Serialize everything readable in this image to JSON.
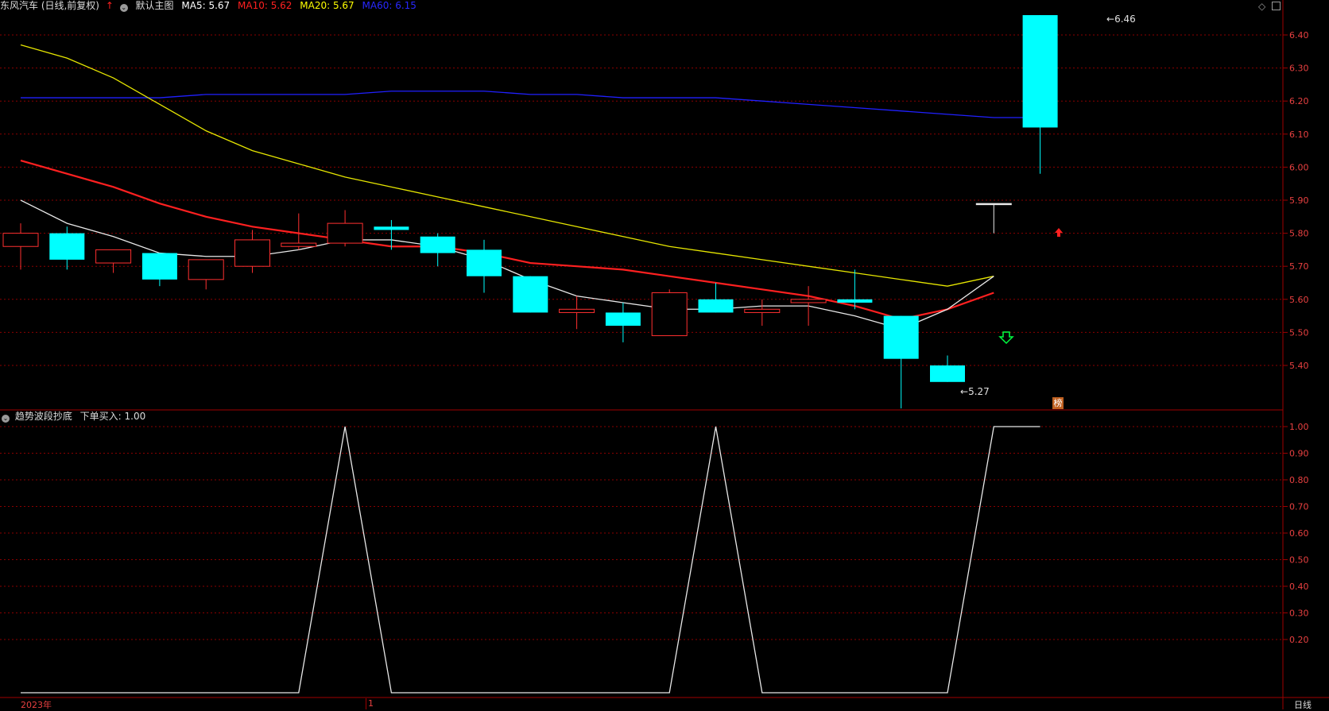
{
  "header": {
    "stock_title": "东风汽车 (日线,前复权)",
    "template_label": "默认主图",
    "ma": [
      {
        "label": "MA5: 5.67",
        "color": "#ffffff"
      },
      {
        "label": "MA10: 5.62",
        "color": "#ff2020"
      },
      {
        "label": "MA20: 5.67",
        "color": "#ffff00"
      },
      {
        "label": "MA60: 6.15",
        "color": "#2020ff"
      }
    ]
  },
  "indicator_header": {
    "name": "趋势波段抄底",
    "value_label": "下单买入: 1.00"
  },
  "bottom": {
    "year_label": "2023年",
    "month_label": "1",
    "period_label": "日线"
  },
  "markers": {
    "low_label": "5.27",
    "high_label": "6.46",
    "bang_label": "榜"
  },
  "chart_data": [
    {
      "type": "candlestick",
      "ylim": [
        5.27,
        6.46
      ],
      "yticks": [
        "6.40",
        "6.30",
        "6.20",
        "6.10",
        "6.00",
        "5.90",
        "5.80",
        "5.70",
        "5.60",
        "5.50",
        "5.40"
      ],
      "candles": [
        {
          "o": 5.76,
          "h": 5.83,
          "l": 5.69,
          "c": 5.8
        },
        {
          "o": 5.8,
          "h": 5.82,
          "l": 5.69,
          "c": 5.72
        },
        {
          "o": 5.71,
          "h": 5.75,
          "l": 5.68,
          "c": 5.75
        },
        {
          "o": 5.74,
          "h": 5.74,
          "l": 5.64,
          "c": 5.66
        },
        {
          "o": 5.66,
          "h": 5.72,
          "l": 5.63,
          "c": 5.72
        },
        {
          "o": 5.7,
          "h": 5.81,
          "l": 5.68,
          "c": 5.78
        },
        {
          "o": 5.76,
          "h": 5.86,
          "l": 5.75,
          "c": 5.77
        },
        {
          "o": 5.77,
          "h": 5.87,
          "l": 5.76,
          "c": 5.83
        },
        {
          "o": 5.82,
          "h": 5.84,
          "l": 5.75,
          "c": 5.81
        },
        {
          "o": 5.79,
          "h": 5.8,
          "l": 5.7,
          "c": 5.74
        },
        {
          "o": 5.75,
          "h": 5.78,
          "l": 5.62,
          "c": 5.67
        },
        {
          "o": 5.67,
          "h": 5.67,
          "l": 5.56,
          "c": 5.56
        },
        {
          "o": 5.56,
          "h": 5.61,
          "l": 5.51,
          "c": 5.57
        },
        {
          "o": 5.56,
          "h": 5.59,
          "l": 5.47,
          "c": 5.52
        },
        {
          "o": 5.49,
          "h": 5.63,
          "l": 5.49,
          "c": 5.62
        },
        {
          "o": 5.6,
          "h": 5.65,
          "l": 5.56,
          "c": 5.56
        },
        {
          "o": 5.56,
          "h": 5.6,
          "l": 5.52,
          "c": 5.57
        },
        {
          "o": 5.59,
          "h": 5.64,
          "l": 5.52,
          "c": 5.6
        },
        {
          "o": 5.6,
          "h": 5.69,
          "l": 5.57,
          "c": 5.59
        },
        {
          "o": 5.55,
          "h": 5.55,
          "l": 5.27,
          "c": 5.42
        },
        {
          "o": 5.4,
          "h": 5.43,
          "l": 5.35,
          "c": 5.35
        },
        {
          "o": 5.89,
          "h": 5.89,
          "l": 5.8,
          "c": 5.89
        },
        {
          "o": 6.46,
          "h": 6.46,
          "l": 5.98,
          "c": 6.12
        }
      ],
      "ma5": [
        5.9,
        5.83,
        5.79,
        5.74,
        5.73,
        5.73,
        5.75,
        5.78,
        5.78,
        5.76,
        5.72,
        5.66,
        5.61,
        5.59,
        5.57,
        5.57,
        5.58,
        5.58,
        5.55,
        5.51,
        5.57,
        5.67
      ],
      "ma10": [
        6.02,
        5.98,
        5.94,
        5.89,
        5.85,
        5.82,
        5.8,
        5.78,
        5.76,
        5.76,
        5.74,
        5.71,
        5.7,
        5.69,
        5.67,
        5.65,
        5.63,
        5.61,
        5.58,
        5.54,
        5.57,
        5.62
      ],
      "ma20": [
        6.37,
        6.33,
        6.27,
        6.19,
        6.11,
        6.05,
        6.01,
        5.97,
        5.94,
        5.91,
        5.88,
        5.85,
        5.82,
        5.79,
        5.76,
        5.74,
        5.72,
        5.7,
        5.68,
        5.66,
        5.64,
        5.67
      ],
      "ma60": [
        6.21,
        6.21,
        6.21,
        6.21,
        6.22,
        6.22,
        6.22,
        6.22,
        6.23,
        6.23,
        6.23,
        6.22,
        6.22,
        6.21,
        6.21,
        6.21,
        6.2,
        6.19,
        6.18,
        6.17,
        6.16,
        6.15,
        6.15
      ]
    },
    {
      "type": "line",
      "name": "下单买入",
      "ylim": [
        0,
        1.05
      ],
      "yticks": [
        "1.00",
        "0.90",
        "0.80",
        "0.70",
        "0.60",
        "0.50",
        "0.40",
        "0.30",
        "0.20"
      ],
      "values": [
        0,
        0,
        0,
        0,
        0,
        0,
        0,
        1,
        0,
        0,
        0,
        0,
        0,
        0,
        0,
        1,
        0,
        0,
        0,
        0,
        0,
        1,
        1
      ]
    }
  ],
  "colors": {
    "up": "#ff3030",
    "down": "#00ffff",
    "grid": "#8b0000",
    "axis_text": "#e84040"
  }
}
